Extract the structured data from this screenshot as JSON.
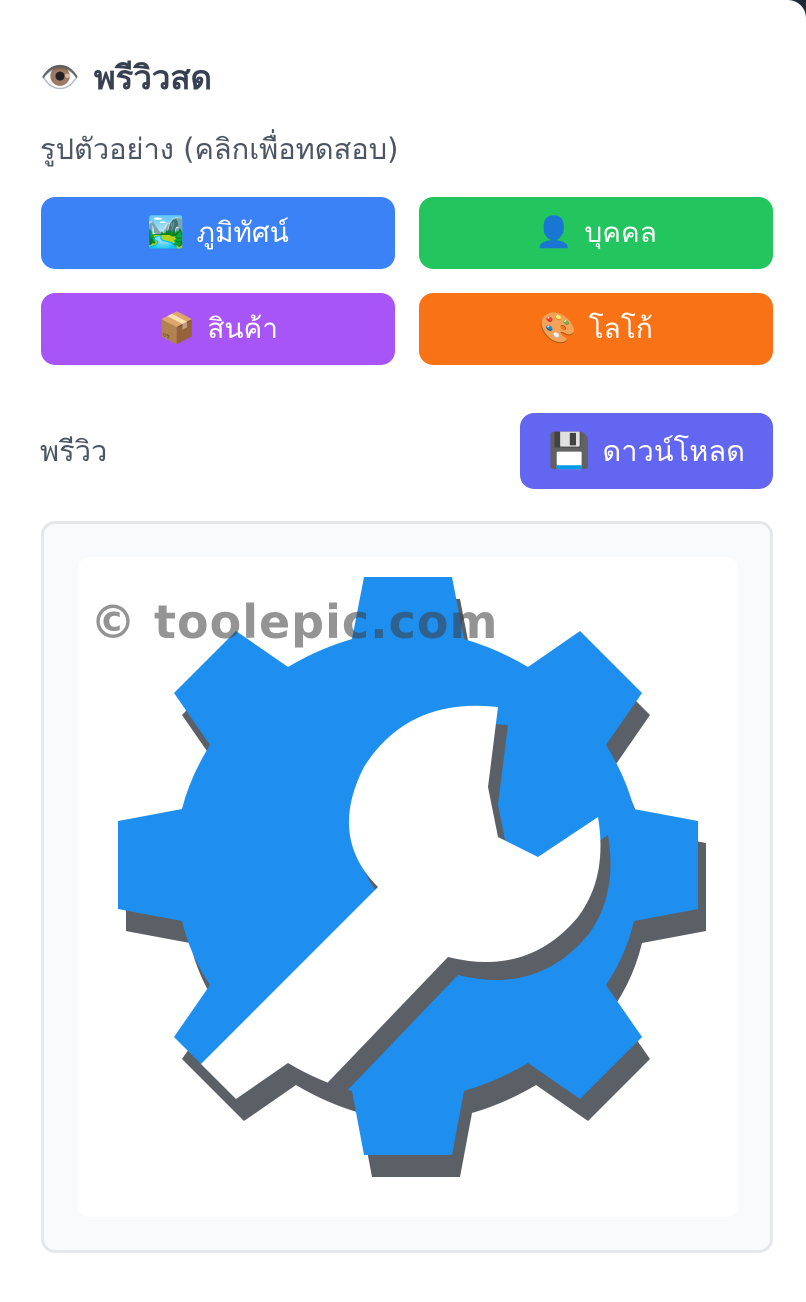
{
  "header": {
    "icon": "eye-icon",
    "title": "พรีวิวสด",
    "subtitle": "รูปตัวอย่าง (คลิกเพื่อทดสอบ)"
  },
  "samples": [
    {
      "id": "landscape",
      "emoji": "🏞️",
      "label": "ภูมิทัศน์",
      "color": "#3b82f6"
    },
    {
      "id": "person",
      "emoji": "👤",
      "label": "บุคคล",
      "color": "#22c55e"
    },
    {
      "id": "product",
      "emoji": "📦",
      "label": "สินค้า",
      "color": "#a855f7"
    },
    {
      "id": "logo",
      "emoji": "🎨",
      "label": "โลโก้",
      "color": "#f97316"
    }
  ],
  "preview": {
    "label": "พรีวิว",
    "download_emoji": "💾",
    "download_label": "ดาวน์โหลด",
    "download_color": "#6366f1",
    "watermark": "© toolepic.com",
    "image_icon": "gear-wrench-icon",
    "image_color": "#1e8fef"
  }
}
